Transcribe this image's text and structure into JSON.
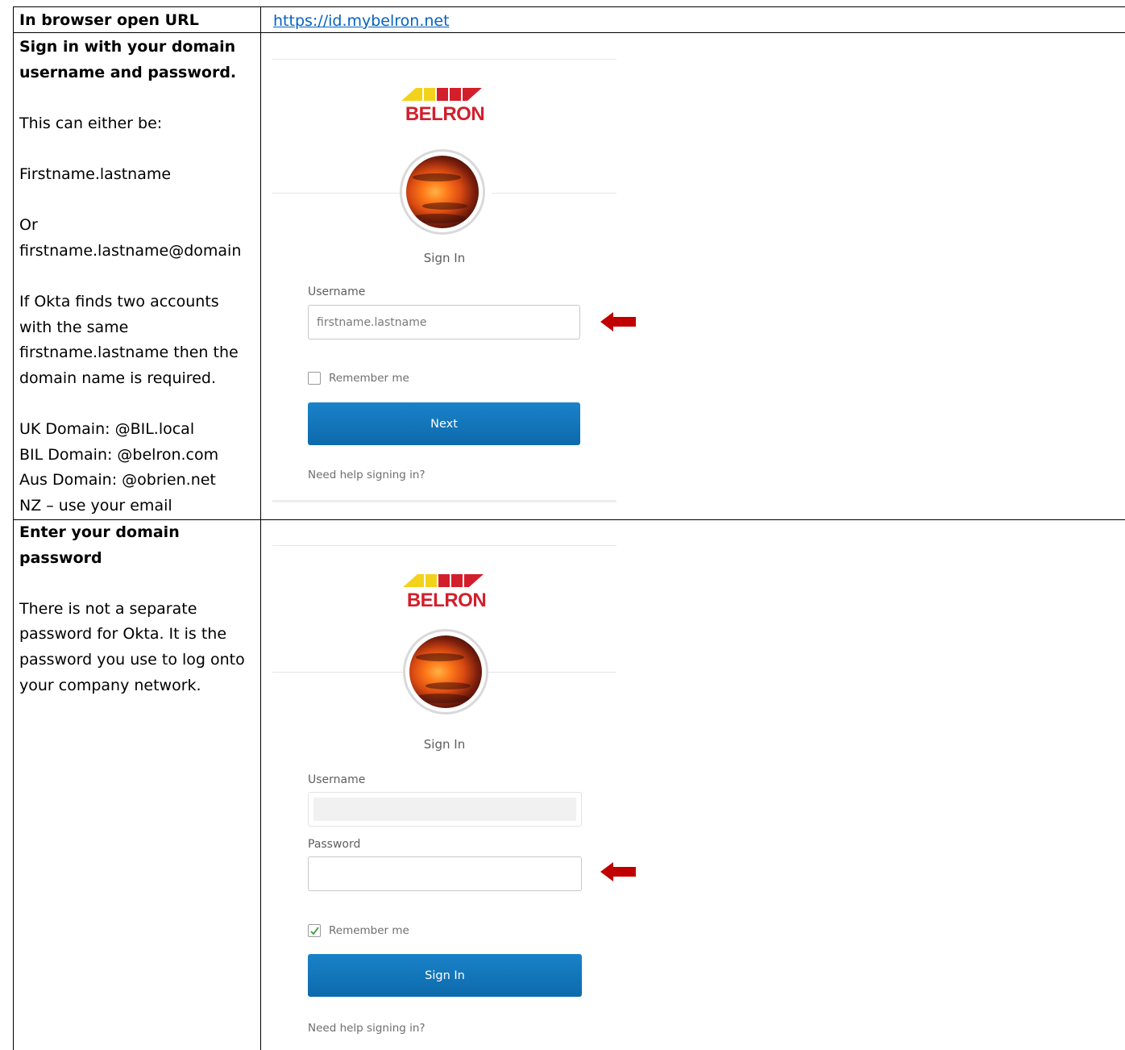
{
  "row1": {
    "label": "In browser open URL",
    "url": "https://id.mybelron.net"
  },
  "row2": {
    "heading": "Sign in with your domain username and password.",
    "lines": [
      "This can either be:",
      "Firstname.lastname",
      "Or",
      "firstname.lastname@domain",
      "If Okta finds two accounts with the same firstname.lastname then the domain name is required.",
      "UK Domain: @BIL.local",
      "BIL Domain: @belron.com",
      "Aus Domain: @obrien.net",
      "NZ – use your email"
    ]
  },
  "row3": {
    "heading": "Enter your domain password",
    "body": "There is not a separate password for Okta. It is the password you use to log onto your company network."
  },
  "okta1": {
    "logo_text": "BELRON",
    "title": "Sign In",
    "username_label": "Username",
    "username_placeholder": "firstname.lastname",
    "remember_label": "Remember me",
    "remember_checked": false,
    "next_button": "Next",
    "help_link": "Need help signing in?"
  },
  "okta2": {
    "logo_text": "BELRON",
    "title": "Sign In",
    "username_label": "Username",
    "password_label": "Password",
    "remember_label": "Remember me",
    "remember_checked": true,
    "signin_button": "Sign In",
    "help_link": "Need help signing in?"
  },
  "colors": {
    "link": "#0563c1",
    "button": "#1177bf",
    "arrow": "#c00000",
    "logo_red": "#d21f2b",
    "logo_yellow": "#f3d21b"
  },
  "icons": [
    "belron-logo",
    "avatar-sunset-image",
    "checkbox-icon",
    "checkmark-icon",
    "left-arrow-icon"
  ]
}
